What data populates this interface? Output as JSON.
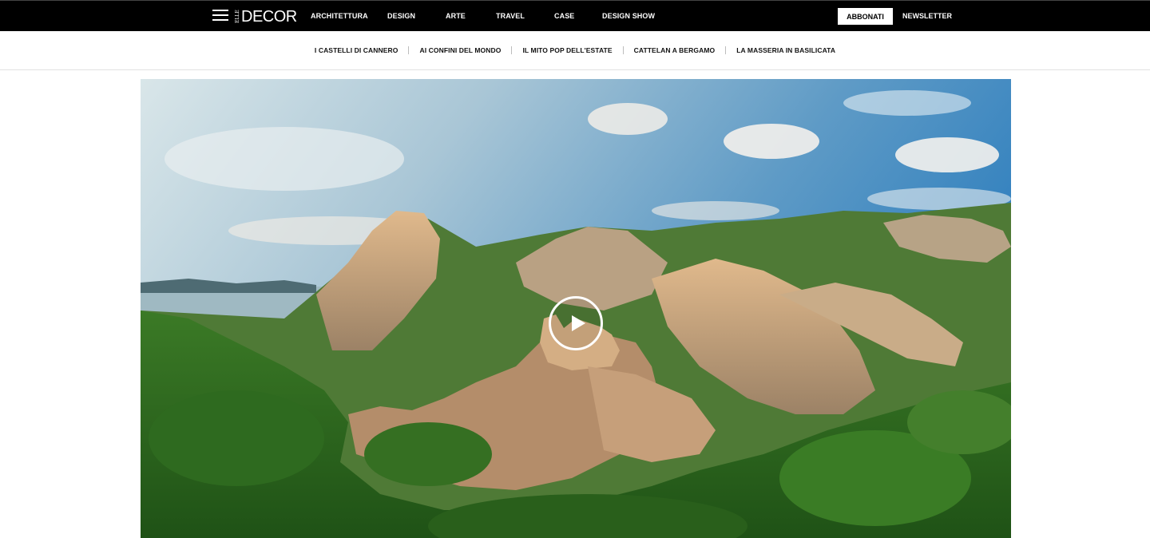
{
  "brand": {
    "logo_small": "ELLE",
    "logo_main": "DECOR"
  },
  "topnav": {
    "items": [
      {
        "label": "ARCHITETTURA"
      },
      {
        "label": "DESIGN"
      },
      {
        "label": "ARTE"
      },
      {
        "label": "TRAVEL"
      },
      {
        "label": "CASE"
      },
      {
        "label": "DESIGN SHOW"
      }
    ],
    "subscribe_label": "ABBONATI",
    "newsletter_label": "NEWSLETTER"
  },
  "subnav": {
    "items": [
      {
        "label": "I CASTELLI DI CANNERO"
      },
      {
        "label": "AI CONFINI DEL MONDO"
      },
      {
        "label": "IL MITO POP DELL'ESTATE"
      },
      {
        "label": "CATTELAN A BERGAMO"
      },
      {
        "label": "LA MASSERIA IN BASILICATA"
      }
    ]
  },
  "hero": {
    "media": "video",
    "icons": {
      "play": "play-icon",
      "menu": "hamburger-icon"
    }
  },
  "colors": {
    "topbar_bg": "#000000",
    "subscribe_bg": "#ffffff",
    "accent_text": "#111111"
  }
}
